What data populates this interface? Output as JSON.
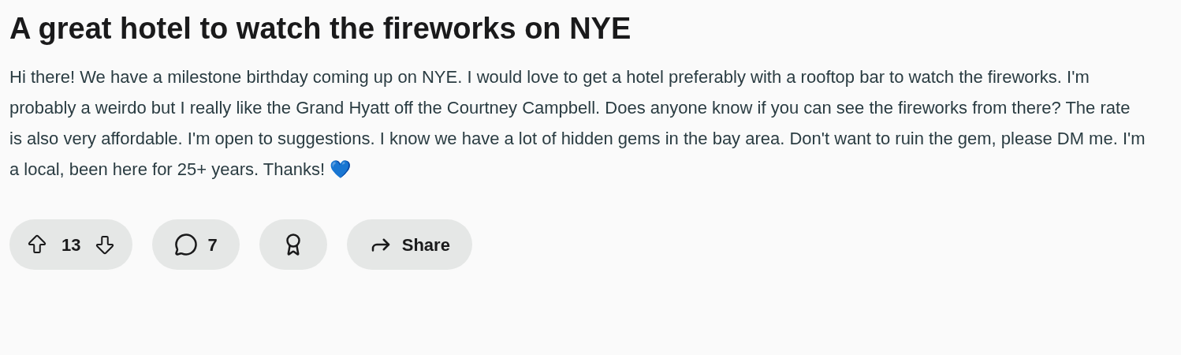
{
  "post": {
    "title": "A great hotel to watch the fireworks on NYE",
    "body": "Hi there! We have a milestone birthday coming up on NYE. I would love to get a hotel preferably with a rooftop bar to watch the fireworks. I'm probably a weirdo but I really like the Grand Hyatt off the Courtney Campbell. Does anyone know if you can see the fireworks from there? The rate is also very affordable. I'm open to suggestions. I know we have a lot of hidden gems in the bay area. Don't want to ruin the gem, please DM me. I'm a local, been here for 25+ years. Thanks! 💙"
  },
  "actions": {
    "votes": "13",
    "comments": "7",
    "share": "Share"
  }
}
